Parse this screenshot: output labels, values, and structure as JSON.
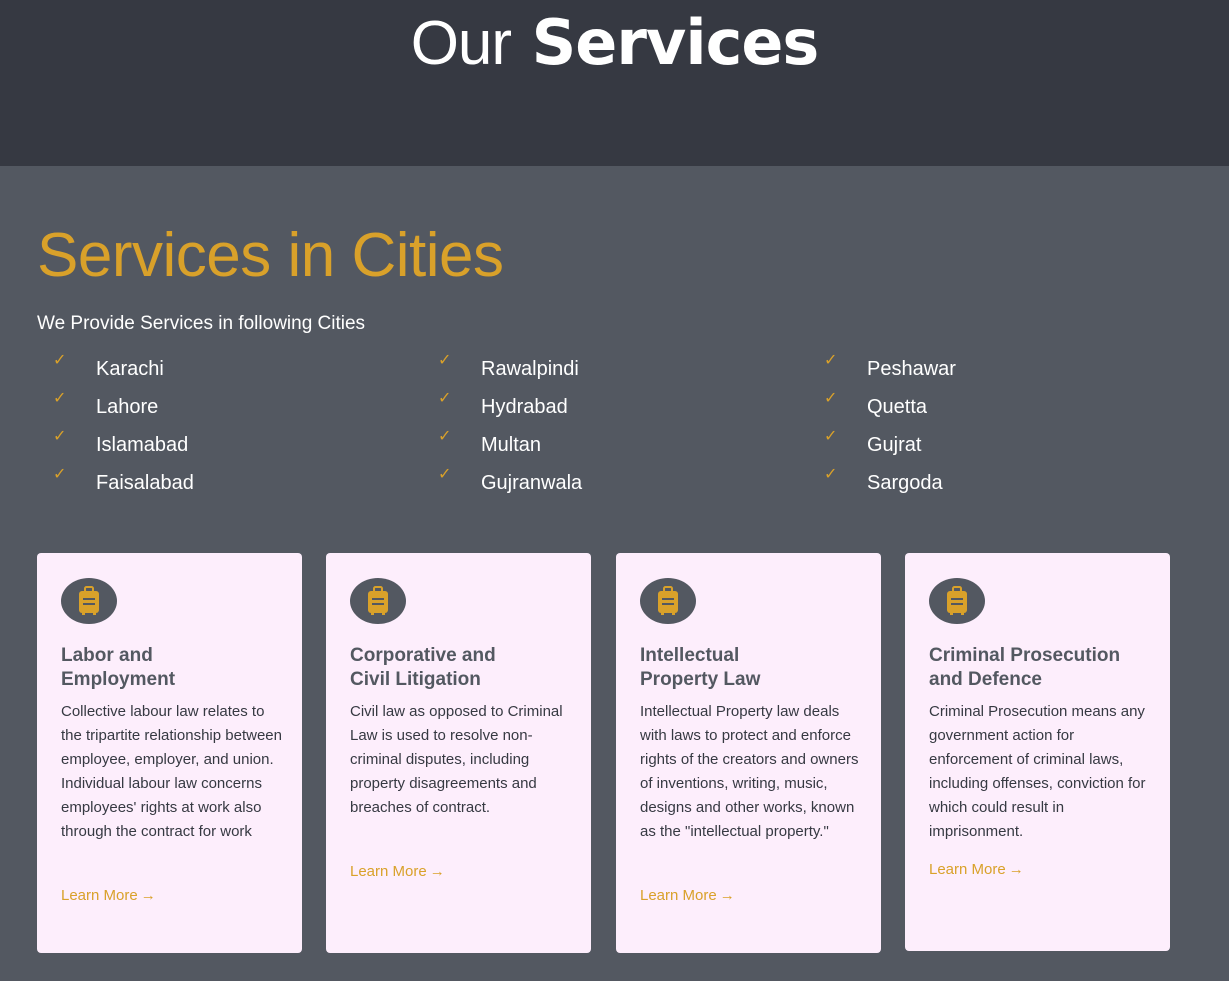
{
  "header": {
    "title_light": "Our",
    "title_bold": "Services"
  },
  "cities_section": {
    "title": "Services in Cities",
    "subtitle": "We Provide Services in following Cities",
    "columns": [
      [
        "Karachi",
        "Lahore",
        "Islamabad",
        "Faisalabad"
      ],
      [
        "Rawalpindi",
        "Hydrabad",
        "Multan",
        "Gujranwala"
      ],
      [
        "Peshawar",
        "Quetta",
        "Gujrat",
        "Sargoda"
      ]
    ],
    "check_icon": "check-icon",
    "accent_color": "#d9a12a"
  },
  "cards": [
    {
      "icon": "suitcase-icon",
      "title": "Labor and\nEmployment",
      "text": "Collective labour law relates to the tripartite relationship between employee, employer, and union. Individual labour law concerns employees' rights at work also through the contract for work",
      "link": "Learn More"
    },
    {
      "icon": "suitcase-icon",
      "title": "Corporative and\nCivil Litigation",
      "text": "Civil law as opposed to Criminal Law is used to resolve non-criminal disputes, including property disagreements and breaches of contract.",
      "link": "Learn More"
    },
    {
      "icon": "suitcase-icon",
      "title": "Intellectual\nProperty Law",
      "text": "Intellectual Property law deals with laws to protect and enforce rights of the creators and owners of inventions, writing, music, designs and other works, known as the \"intellectual property.\"",
      "link": "Learn More"
    },
    {
      "icon": "suitcase-icon",
      "title": "Criminal Prosecution\nand Defence",
      "text": "Criminal Prosecution means any government action for enforcement of criminal laws, including offenses, conviction for which could result in imprisonment.",
      "link": "Learn More"
    }
  ],
  "colors": {
    "hero_bg": "#363942",
    "page_bg": "#535861",
    "card_bg": "#fdeefc",
    "accent": "#d9a12a"
  }
}
